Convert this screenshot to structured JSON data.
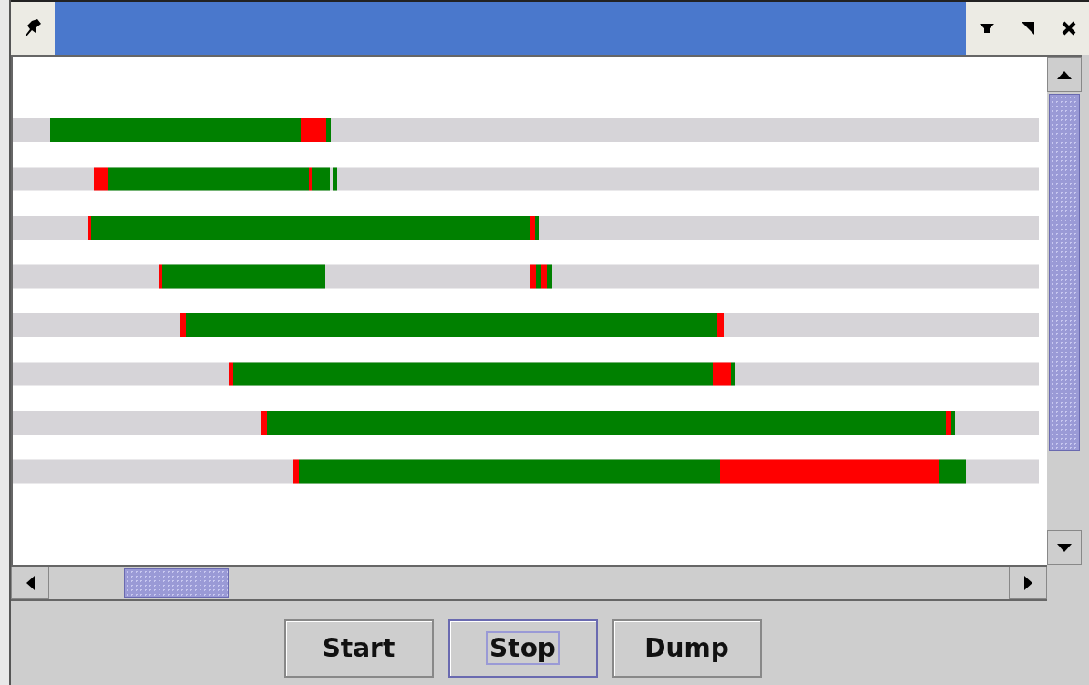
{
  "buttons": [
    {
      "label": "Start",
      "focused": false
    },
    {
      "label": "Stop",
      "focused": true
    },
    {
      "label": "Dump",
      "focused": false
    }
  ]
}
